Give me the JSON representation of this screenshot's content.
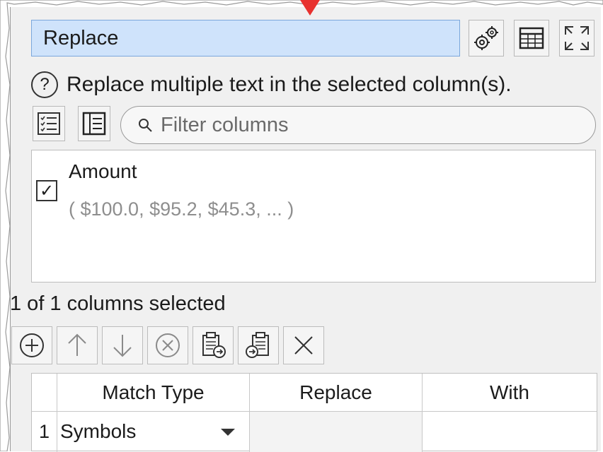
{
  "panel": {
    "title": "Replace",
    "description": "Replace multiple text in the selected column(s).",
    "accent_color": "#cfe3fb",
    "pointer_color": "#e8322f"
  },
  "toolbar_icons": [
    "gear-icon",
    "table-icon",
    "maximize-icon"
  ],
  "filter": {
    "placeholder": "Filter columns"
  },
  "columns": {
    "items": [
      {
        "name": "Amount",
        "sample": "( $100.0, $95.2, $45.3, ... )",
        "checked": true
      }
    ],
    "selected_count": "1 of 1 columns selected"
  },
  "actions": [
    "add-icon",
    "move-up-icon",
    "move-down-icon",
    "delete-icon",
    "paste-icon",
    "copy-icon",
    "clear-icon"
  ],
  "table": {
    "headers": [
      "Match Type",
      "Replace",
      "With"
    ],
    "rows": [
      {
        "num": "1",
        "match_type": "Symbols",
        "replace": "",
        "with": ""
      }
    ]
  }
}
